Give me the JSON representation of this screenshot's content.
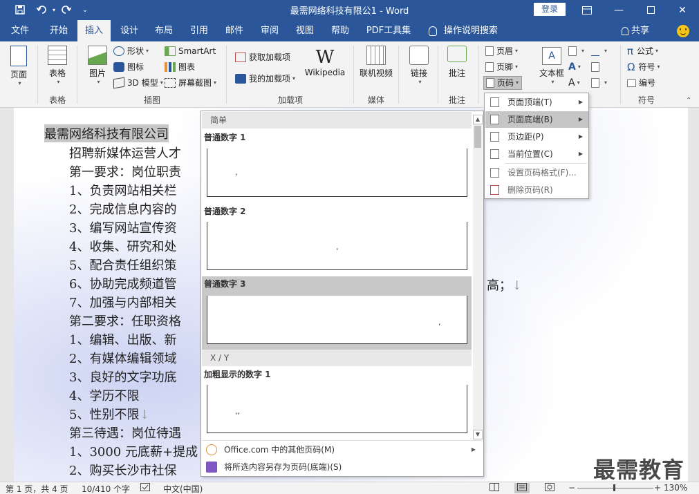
{
  "window": {
    "title": "最需网络科技有限公1 - Word",
    "login_label": "登录"
  },
  "tabs": [
    "文件",
    "开始",
    "插入",
    "设计",
    "布局",
    "引用",
    "邮件",
    "审阅",
    "视图",
    "帮助",
    "PDF工具集"
  ],
  "active_tab": "插入",
  "tell_me": "操作说明搜索",
  "share_label": "共享",
  "ribbon": {
    "pages": "页面",
    "table": "表格",
    "picture": "图片",
    "shapes": "形状",
    "icons": "图标",
    "model3d": "3D 模型",
    "smartart": "SmartArt",
    "chart": "图表",
    "screenshot": "屏幕截图",
    "get_addins": "获取加载项",
    "my_addins": "我的加载项",
    "wikipedia": "Wikipedia",
    "online_video": "联机视频",
    "link": "链接",
    "comment": "批注",
    "header": "页眉",
    "footer": "页脚",
    "page_number": "页码",
    "textbox": "文本框",
    "equation": "公式",
    "symbol": "符号",
    "numbering": "编号",
    "groups": {
      "table": "表格",
      "illustrations": "插图",
      "addins": "加载项",
      "media": "媒体",
      "comments": "批注",
      "symbols": "符号"
    }
  },
  "document": {
    "title": "最需网络科技有限公司",
    "lines": [
      "招聘新媒体运营人才",
      "第一要求：岗位职责",
      "1、负责网站相关栏",
      "2、完成信息内容的",
      "3、编写网站宣传资",
      "4、收集、研究和处",
      "5、配合责任组织策",
      "6、协助完成频道管",
      "7、加强与内部相关",
      "第二要求：任职资格",
      "1、编辑、出版、新",
      "2、有媒体编辑领域",
      "3、良好的文字功底",
      "4、学历不限",
      "5、性别不限",
      "第三待遇：岗位待遇",
      "1、3000 元底薪+提成",
      "2、购买长沙市社保"
    ],
    "line6_tail": "高；"
  },
  "gallery": {
    "section1": "简单",
    "items": [
      {
        "label": "普通数字 1",
        "mark": ","
      },
      {
        "label": "普通数字 2",
        "mark": ","
      },
      {
        "label": "普通数字 3",
        "mark": ","
      }
    ],
    "section2": "X / Y",
    "item4": {
      "label": "加粗显示的数字 1",
      "mark": ",,"
    },
    "more": "Office.com 中的其他页码(M)",
    "save": "将所选内容另存为页码(底端)(S)"
  },
  "submenu": {
    "items": [
      {
        "label": "页面顶端(T)",
        "arrow": true
      },
      {
        "label": "页面底端(B)",
        "arrow": true
      },
      {
        "label": "页边距(P)",
        "arrow": true
      },
      {
        "label": "当前位置(C)",
        "arrow": true
      },
      {
        "label": "设置页码格式(F)...",
        "arrow": false
      },
      {
        "label": "删除页码(R)",
        "arrow": false
      }
    ]
  },
  "status": {
    "page": "第 1 页，共 4 页",
    "words": "10/410 个字",
    "lang": "中文(中国)",
    "zoom": "130%"
  },
  "watermark": "最需教育",
  "colors": {
    "brand": "#2b579a",
    "ribbon_bg": "#f3f3f3"
  }
}
